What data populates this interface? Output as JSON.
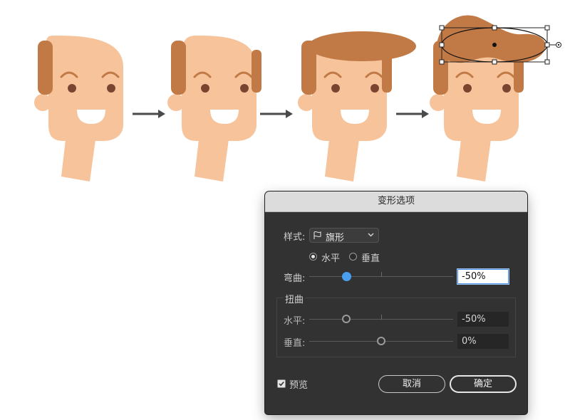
{
  "dialog": {
    "title": "变形选项",
    "style_label": "样式:",
    "style_value": "旗形",
    "orientation": {
      "horizontal_label": "水平",
      "vertical_label": "垂直",
      "selected": "horizontal"
    },
    "bend": {
      "label": "弯曲:",
      "value": "-50%",
      "slider_fraction": 0.25
    },
    "distortion": {
      "group_label": "扭曲",
      "horizontal": {
        "label": "水平:",
        "value": "-50%",
        "slider_fraction": 0.25
      },
      "vertical": {
        "label": "垂直:",
        "value": "0%",
        "slider_fraction": 0.5
      }
    },
    "preview": {
      "label": "预览",
      "checked": true
    },
    "cancel_label": "取消",
    "ok_label": "确定"
  },
  "colors": {
    "skin": "#f7c39b",
    "hair": "#c17a45",
    "eye": "#7a4530",
    "accent": "#4a9ef0"
  },
  "icons": [
    "flag-style-icon",
    "chevron-down-icon",
    "arrow-right-icon",
    "check-icon",
    "anchor-point-icon"
  ]
}
